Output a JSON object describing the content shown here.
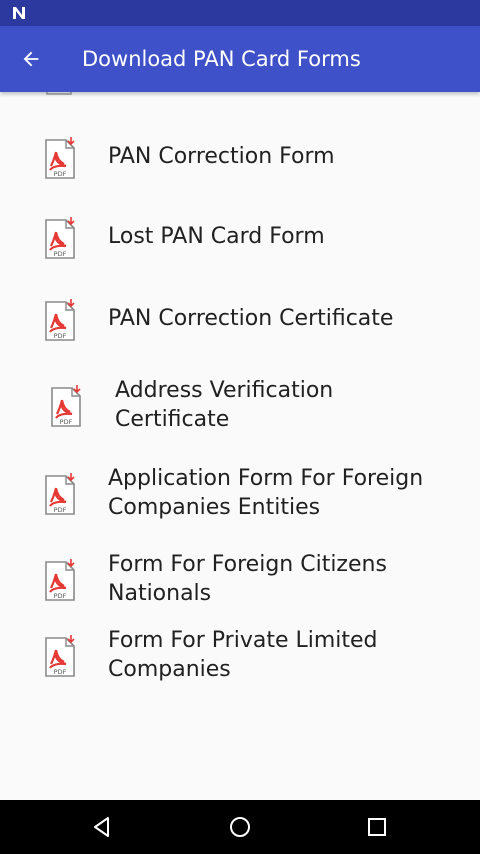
{
  "app_bar": {
    "title": "Download PAN Card Forms"
  },
  "forms": [
    {
      "label": "PAN Correction Form"
    },
    {
      "label": "Lost PAN Card Form"
    },
    {
      "label": "PAN Correction Certificate"
    },
    {
      "label": "Address Verification Certificate"
    },
    {
      "label": "Application Form For Foreign Companies Entities"
    },
    {
      "label": "Form For Foreign Citizens Nationals"
    },
    {
      "label": "Form For Private Limited Companies"
    }
  ],
  "icons": {
    "status": "notification-n-icon",
    "back": "arrow-left-icon",
    "file": "pdf-file-icon",
    "nav_back": "triangle-back-icon",
    "nav_home": "circle-home-icon",
    "nav_recents": "square-recents-icon"
  },
  "colors": {
    "status_bar": "#2c3aa0",
    "app_bar": "#3f51c8",
    "pdf_red": "#e53935",
    "text": "#212121",
    "nav_bar": "#000000"
  },
  "pdf_icon_text": "PDF"
}
